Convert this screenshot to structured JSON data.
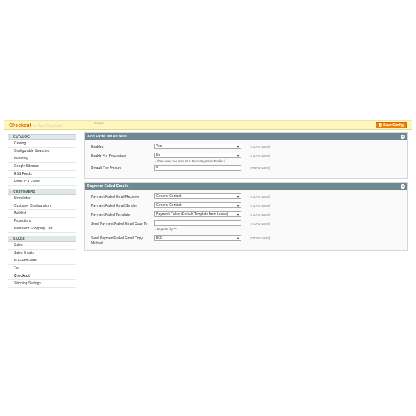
{
  "header": {
    "scope_hint": "Scope:",
    "title": "Checkout",
    "title_sub": "for Test Checkout",
    "save_label": "Save Config"
  },
  "sidebar": {
    "groups": [
      {
        "label": "CATALOG",
        "items": [
          "Catalog",
          "Configurable Swatches",
          "Inventory",
          "Google Sitemap",
          "RSS Feeds",
          "Email to a Friend"
        ]
      },
      {
        "label": "CUSTOMERS",
        "items": [
          "Newsletter",
          "Customer Configuration",
          "Wishlist",
          "Promotions",
          "Persistent Shopping Cart"
        ]
      },
      {
        "label": "SALES",
        "items": [
          "Sales",
          "Sales Emails",
          "PDF Print-outs",
          "Tax",
          "Checkout",
          "Shipping Settings"
        ]
      }
    ]
  },
  "sections": {
    "extra_fee": {
      "title": "Add Extra fee on total",
      "enabled_label": "Enabled",
      "enabled_value": "Yes",
      "percentage_label": "Enable For Percentage",
      "percentage_value": "No",
      "percentage_note": "≈ If You need Fee Amount in Percentage then Enable it",
      "default_fee_label": "Default Fee Amount",
      "default_fee_value": "0",
      "scope": "[STORE VIEW]"
    },
    "payment_failed": {
      "title": "Payment Failed Emails",
      "receiver_label": "Payment Failed Email Reciever",
      "receiver_value": "General Contact",
      "sender_label": "Payment Failed Email Sender",
      "sender_value": "General Contact",
      "template_label": "Payment Failed Template",
      "template_value": "Payment Failed (Default Template from Locale)",
      "copy_to_label": "Send Payment Failed Email Copy To",
      "copy_to_value": "",
      "copy_to_note": "≈ Separate by \",\".",
      "copy_method_label": "Send Payment Failed Email Copy Method",
      "copy_method_value": "Bcc",
      "scope": "[STORE VIEW]"
    }
  },
  "icons": {
    "collapse": "collapse-icon",
    "save": "save-icon",
    "caret": "chevron-down-icon",
    "arrow": "collapse-arrow-icon"
  },
  "colors": {
    "accent": "#e26703",
    "save_button": "#f18200",
    "section_header": "#6f8992",
    "header_bar": "#fdf6bf"
  }
}
